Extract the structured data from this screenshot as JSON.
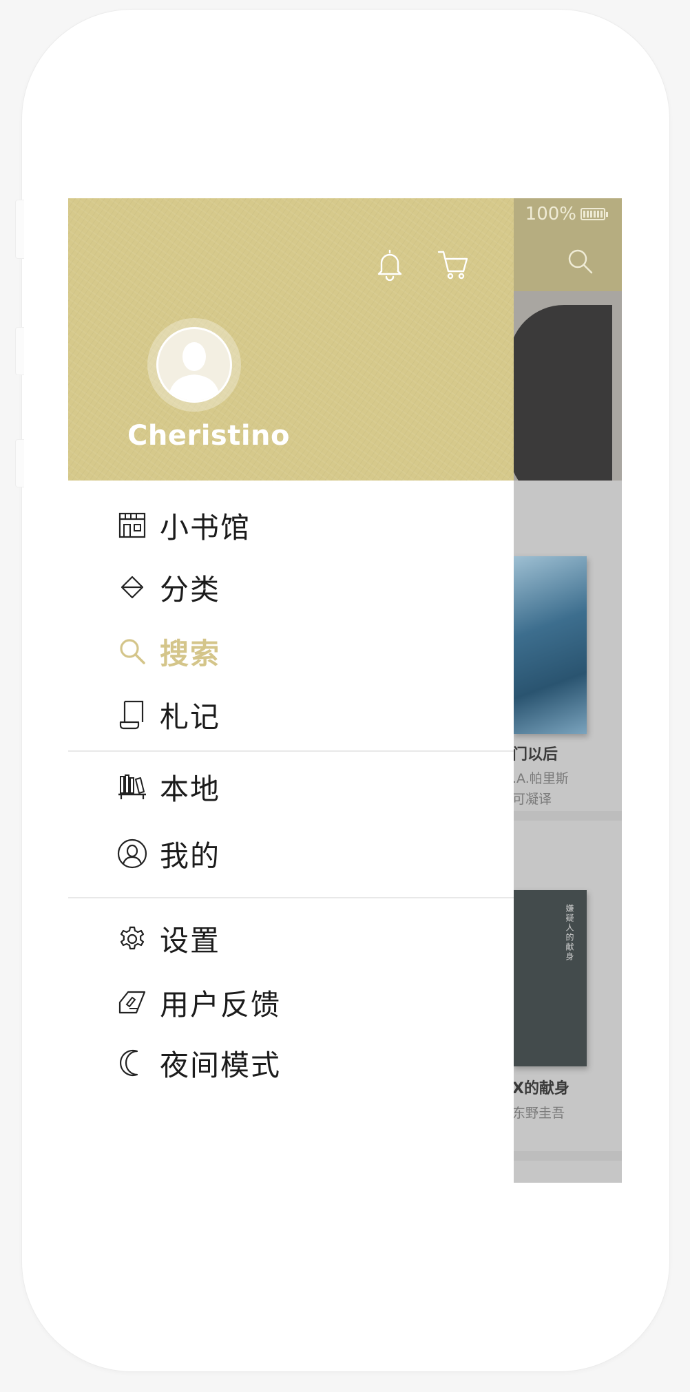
{
  "status": {
    "battery": "100%"
  },
  "drawer": {
    "username": "Cheristino",
    "menu_group1": [
      {
        "label": "小书馆",
        "icon": "bookstore-icon"
      },
      {
        "label": "分类",
        "icon": "category-icon"
      },
      {
        "label": "搜索",
        "icon": "search-icon",
        "active": true
      },
      {
        "label": "札记",
        "icon": "notes-icon"
      }
    ],
    "menu_group2": [
      {
        "label": "本地",
        "icon": "bookshelf-icon"
      },
      {
        "label": "我的",
        "icon": "profile-icon"
      }
    ],
    "menu_group3": [
      {
        "label": "设置",
        "icon": "gear-icon"
      },
      {
        "label": "用户反馈",
        "icon": "feedback-icon"
      },
      {
        "label": "夜间模式",
        "icon": "moon-icon"
      }
    ]
  },
  "background": {
    "book1": {
      "title": "门以后",
      "author": ".A.帕里斯",
      "translator": "可凝译"
    },
    "book2": {
      "title": "X的献身",
      "author": "东野圭吾",
      "cover_text": "嫌疑人的献身"
    }
  },
  "colors": {
    "accent": "#d4c58a",
    "header_bg": "#d6c98b",
    "topbar_bg": "#b6ad80"
  }
}
